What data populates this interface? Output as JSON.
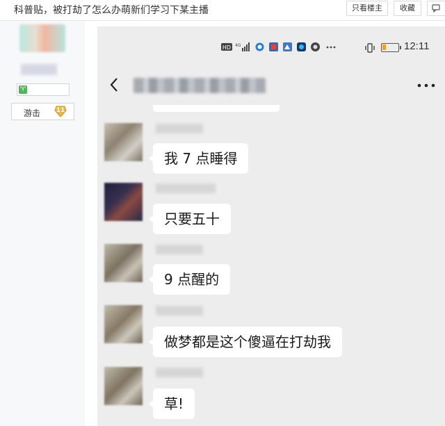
{
  "topbar": {
    "title": "科普贴，被打劫了怎么办萌新们学习下某主播",
    "only_author_label": "只看楼主",
    "favorite_label": "收藏",
    "reply_icon": "reply-icon"
  },
  "sidebar": {
    "follow_label": "游击",
    "level_badge": "11",
    "level_icon": "leaf-level-icon"
  },
  "phone": {
    "clock": "12:11",
    "status_icons": [
      "hd-icon",
      "4g-signal-icon",
      "app-icon",
      "app-icon",
      "app-icon",
      "app-icon",
      "app-icon",
      "more-dots-icon"
    ],
    "header_icons": [
      "back-icon",
      "more-icon"
    ],
    "messages": [
      {
        "text": "我 7 点睡得"
      },
      {
        "text": "只要五十"
      },
      {
        "text": "9 点醒的"
      },
      {
        "text": "做梦都是这个傻逼在打劫我"
      },
      {
        "text": "草!"
      }
    ]
  },
  "colors": {
    "chat_bg": "#ededed",
    "bubble_bg": "#ffffff",
    "sidebar_bg": "#f7f8fa",
    "battery_level": "#f0a020"
  }
}
